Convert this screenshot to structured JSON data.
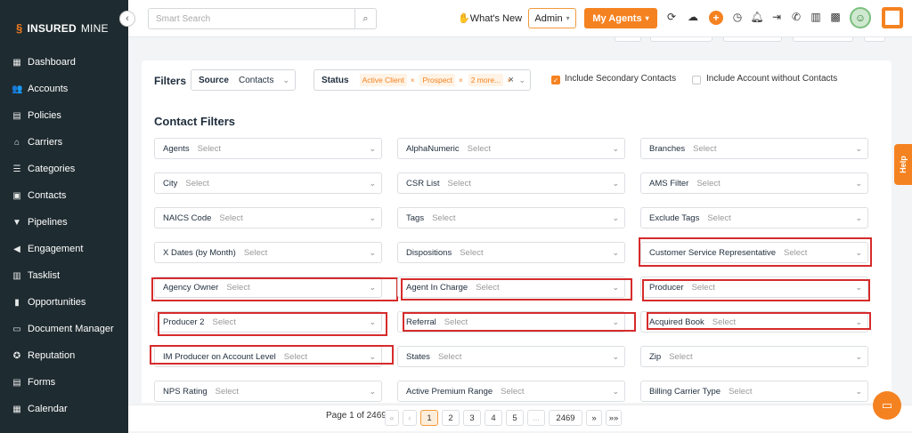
{
  "brand": {
    "logo_bold": "INSUREDMINE",
    "logo_part1": "INSURED",
    "logo_part2": "MINE",
    "accent": "#f58220",
    "sidebar_bg": "#1e2b30"
  },
  "sidebar": {
    "items": [
      {
        "label": "Dashboard",
        "icon": "dashboard-icon"
      },
      {
        "label": "Accounts",
        "icon": "accounts-icon"
      },
      {
        "label": "Policies",
        "icon": "policies-icon"
      },
      {
        "label": "Carriers",
        "icon": "carriers-icon"
      },
      {
        "label": "Categories",
        "icon": "categories-icon"
      },
      {
        "label": "Contacts",
        "icon": "contacts-icon"
      },
      {
        "label": "Pipelines",
        "icon": "pipelines-icon"
      },
      {
        "label": "Engagement",
        "icon": "engagement-icon"
      },
      {
        "label": "Tasklist",
        "icon": "tasklist-icon"
      },
      {
        "label": "Opportunities",
        "icon": "opportunities-icon"
      },
      {
        "label": "Document Manager",
        "icon": "folder-icon"
      },
      {
        "label": "Reputation",
        "icon": "reputation-icon"
      },
      {
        "label": "Forms",
        "icon": "forms-icon"
      },
      {
        "label": "Calendar",
        "icon": "calendar-icon"
      }
    ]
  },
  "topbar": {
    "search_placeholder": "Smart Search",
    "whats_new": "What's New",
    "admin": "Admin",
    "my_agents": "My Agents"
  },
  "filters": {
    "label": "Filters",
    "source_key": "Source",
    "source_value": "Contacts",
    "status_key": "Status",
    "status_chips": [
      "Active Client",
      "Prospect",
      "2 more..."
    ],
    "include_secondary": "Include Secondary Contacts",
    "include_secondary_checked": true,
    "include_without": "Include Account without Contacts",
    "include_without_checked": false
  },
  "contact_filters": {
    "title": "Contact Filters",
    "placeholder": "Select",
    "fields": [
      {
        "label": "Agents"
      },
      {
        "label": "AlphaNumeric"
      },
      {
        "label": "Branches"
      },
      {
        "label": "City"
      },
      {
        "label": "CSR List"
      },
      {
        "label": "AMS Filter"
      },
      {
        "label": "NAICS Code"
      },
      {
        "label": "Tags"
      },
      {
        "label": "Exclude Tags"
      },
      {
        "label": "X Dates (by Month)"
      },
      {
        "label": "Dispositions"
      },
      {
        "label": "Customer Service Representative",
        "highlighted": true
      },
      {
        "label": "Agency Owner",
        "highlighted": true
      },
      {
        "label": "Agent In Charge",
        "highlighted": true
      },
      {
        "label": "Producer",
        "highlighted": true
      },
      {
        "label": "Producer 2",
        "highlighted": true
      },
      {
        "label": "Referral",
        "highlighted": true
      },
      {
        "label": "Acquired Book",
        "highlighted": true
      },
      {
        "label": "IM Producer on Account Level",
        "highlighted": true
      },
      {
        "label": "States"
      },
      {
        "label": "Zip"
      },
      {
        "label": "NPS Rating"
      },
      {
        "label": "Active Premium Range"
      },
      {
        "label": "Billing Carrier Type"
      }
    ]
  },
  "pagination": {
    "text": "Page 1 of 2469",
    "first": "«‹",
    "prev": "‹",
    "pages": [
      "1",
      "2",
      "3",
      "4",
      "5",
      "...",
      "2469"
    ],
    "current": "1",
    "next": "»",
    "last": "»»"
  },
  "help": {
    "label": "Help"
  },
  "highlight_color": "#d62b2b"
}
